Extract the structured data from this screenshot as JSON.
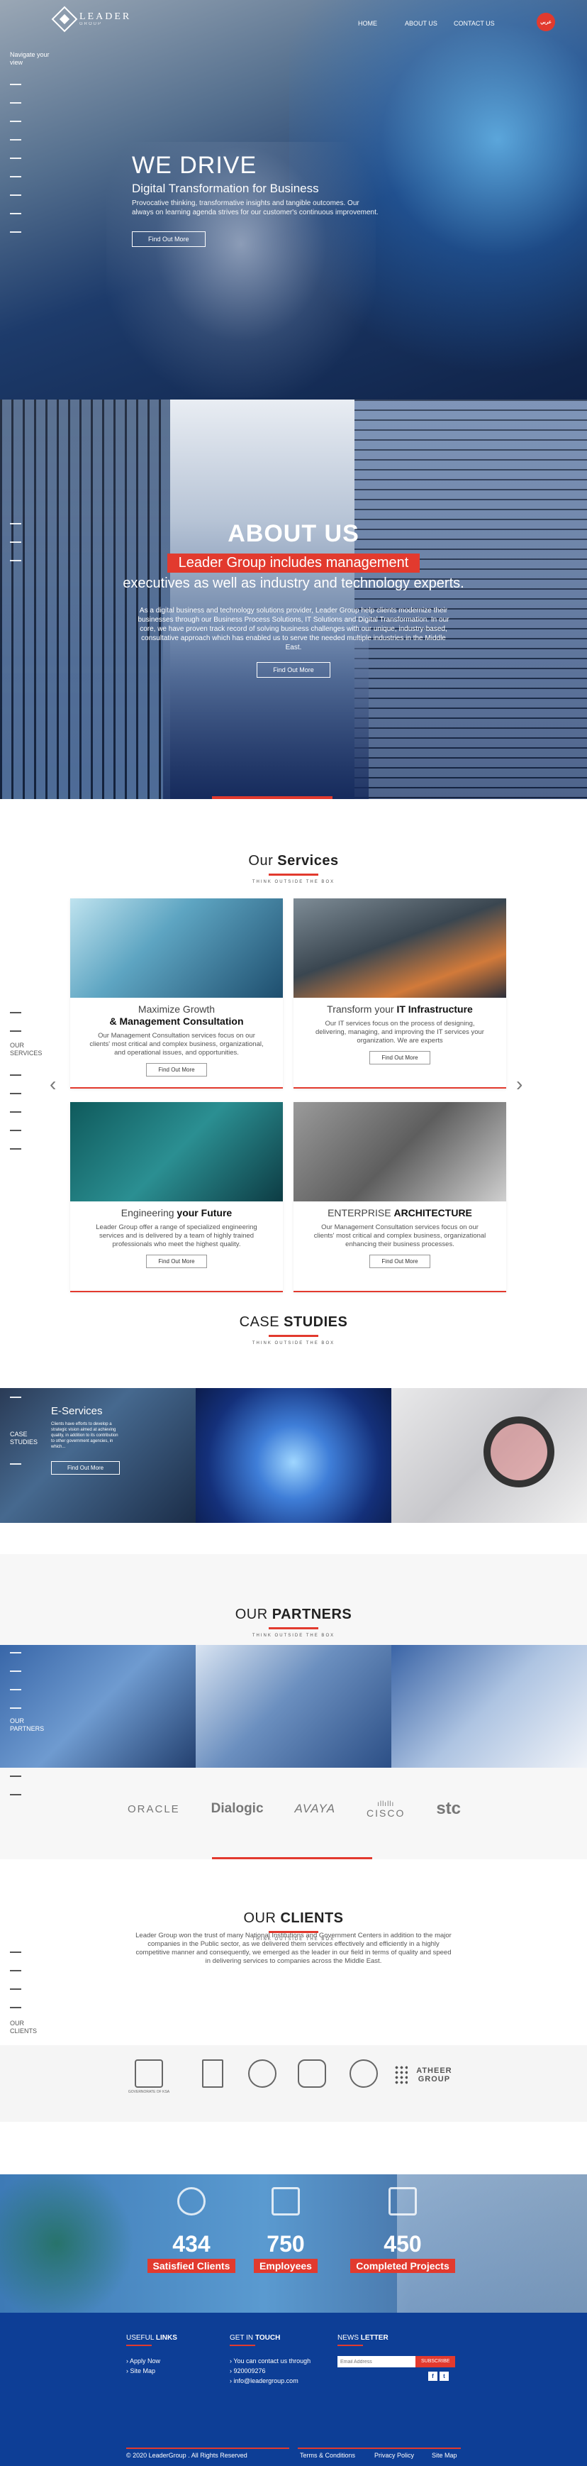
{
  "header": {
    "logo_text": "LEADER",
    "logo_sub": "GROUP",
    "nav": [
      "HOME",
      "ABOUT US",
      "CONTACT US"
    ],
    "lang_button": "عربي"
  },
  "side_nav": {
    "label": "Navigate your view"
  },
  "hero": {
    "title": "WE DRIVE",
    "subtitle": "Digital Transformation for Business",
    "text": "Provocative thinking, transformative insights and tangible outcomes. Our always on learning agenda strives for our customer's continuous improvement.",
    "button": "Find Out More"
  },
  "about": {
    "title": "ABOUT US",
    "highlight": "Leader Group includes management",
    "line2": "executives as well as industry and technology experts.",
    "text": "As a digital business and technology solutions provider, Leader Group help clients modernize their businesses through our Business Process Solutions, IT Solutions and Digital Transformation. In our core, we have proven track record of solving business challenges with our unique, industry-based, consultative approach which has enabled us to serve the needed multiple industries in the Middle East.",
    "button": "Find Out More"
  },
  "services": {
    "title_plain": "Our",
    "title_bold": "Services",
    "tagline": "THINK OUTSIDE THE BOX",
    "rail_label": "OUR SERVICES",
    "cards": [
      {
        "title_plain": "Maximize Growth",
        "title_bold": "& Management Consultation",
        "text": "Our Management Consultation services focus on our clients' most critical and complex business, organizational, and operational issues, and opportunities.",
        "button": "Find Out More"
      },
      {
        "title_plain": "Transform your",
        "title_bold": "IT Infrastructure",
        "text": "Our IT services focus on the process of designing, delivering, managing, and improving the IT services your organization. We are experts",
        "button": "Find Out More"
      },
      {
        "title_plain": "Engineering",
        "title_bold": "your Future",
        "text": "Leader Group offer a range of specialized engineering services and is delivered by a team of highly trained professionals who meet the highest quality.",
        "button": "Find Out More"
      },
      {
        "title_plain": "ENTERPRISE",
        "title_bold": "ARCHITECTURE",
        "text": "Our Management Consultation services focus on our clients' most critical and complex business, organizational enhancing their business processes.",
        "button": "Find Out More"
      }
    ]
  },
  "cases": {
    "title_plain": "CASE",
    "title_bold": "STUDIES",
    "tagline": "THINK OUTSIDE THE BOX",
    "rail_label": "CASE STUDIES",
    "featured": {
      "title": "E-Services",
      "text": "Clients have efforts to develop a strategic vision aimed at achieving quality, in addition to its contribution to other government agencies, in which...",
      "button": "Find Out More"
    }
  },
  "partners": {
    "title_plain": "OUR",
    "title_bold": "PARTNERS",
    "tagline": "THINK OUTSIDE THE BOX",
    "rail_label": "OUR PARTNERS",
    "logos": [
      "ORACLE",
      "Dialogic",
      "AVAYA",
      "CISCO",
      "stc"
    ]
  },
  "clients": {
    "title_plain": "OUR",
    "title_bold": "CLIENTS",
    "tagline": "THINK OUTSIDE THE BOX",
    "rail_label": "OUR CLIENTS",
    "text": "Leader Group won the trust of many National Institutions and Government Centers in addition to the major companies in the Public sector, as we delivered them services effectively and efficiently in a highly competitive manner and consequently, we emerged as the leader in our field in terms of quality and speed in delivering services to companies across the Middle East.",
    "logos": [
      "GOVERNORATE OF KSA",
      "",
      "",
      "",
      "",
      "ATHEER GROUP"
    ]
  },
  "stats": [
    {
      "value": "434",
      "label": "Satisfied Clients"
    },
    {
      "value": "750",
      "label": "Employees"
    },
    {
      "value": "450",
      "label": "Completed Projects"
    }
  ],
  "footer": {
    "useful_plain": "USEFUL",
    "useful_bold": "LINKS",
    "useful_links": [
      "Apply Now",
      "Site Map"
    ],
    "touch_plain": "GET IN",
    "touch_bold": "TOUCH",
    "touch_lines": [
      "You can contact us through",
      "920009276",
      "info@leadergroup.com"
    ],
    "news_plain": "NEWS",
    "news_bold": "LETTER",
    "news_placeholder": "Email Address",
    "news_button": "SUBSCRIBE",
    "social": [
      "f",
      "t"
    ],
    "copyright": "© 2020 LeaderGroup . All Rights Reserved",
    "bottom_links": [
      "Terms & Conditions",
      "Privacy Policy",
      "Site Map"
    ]
  },
  "colors": {
    "accent": "#e23a2e",
    "footer": "#0d3e96"
  }
}
